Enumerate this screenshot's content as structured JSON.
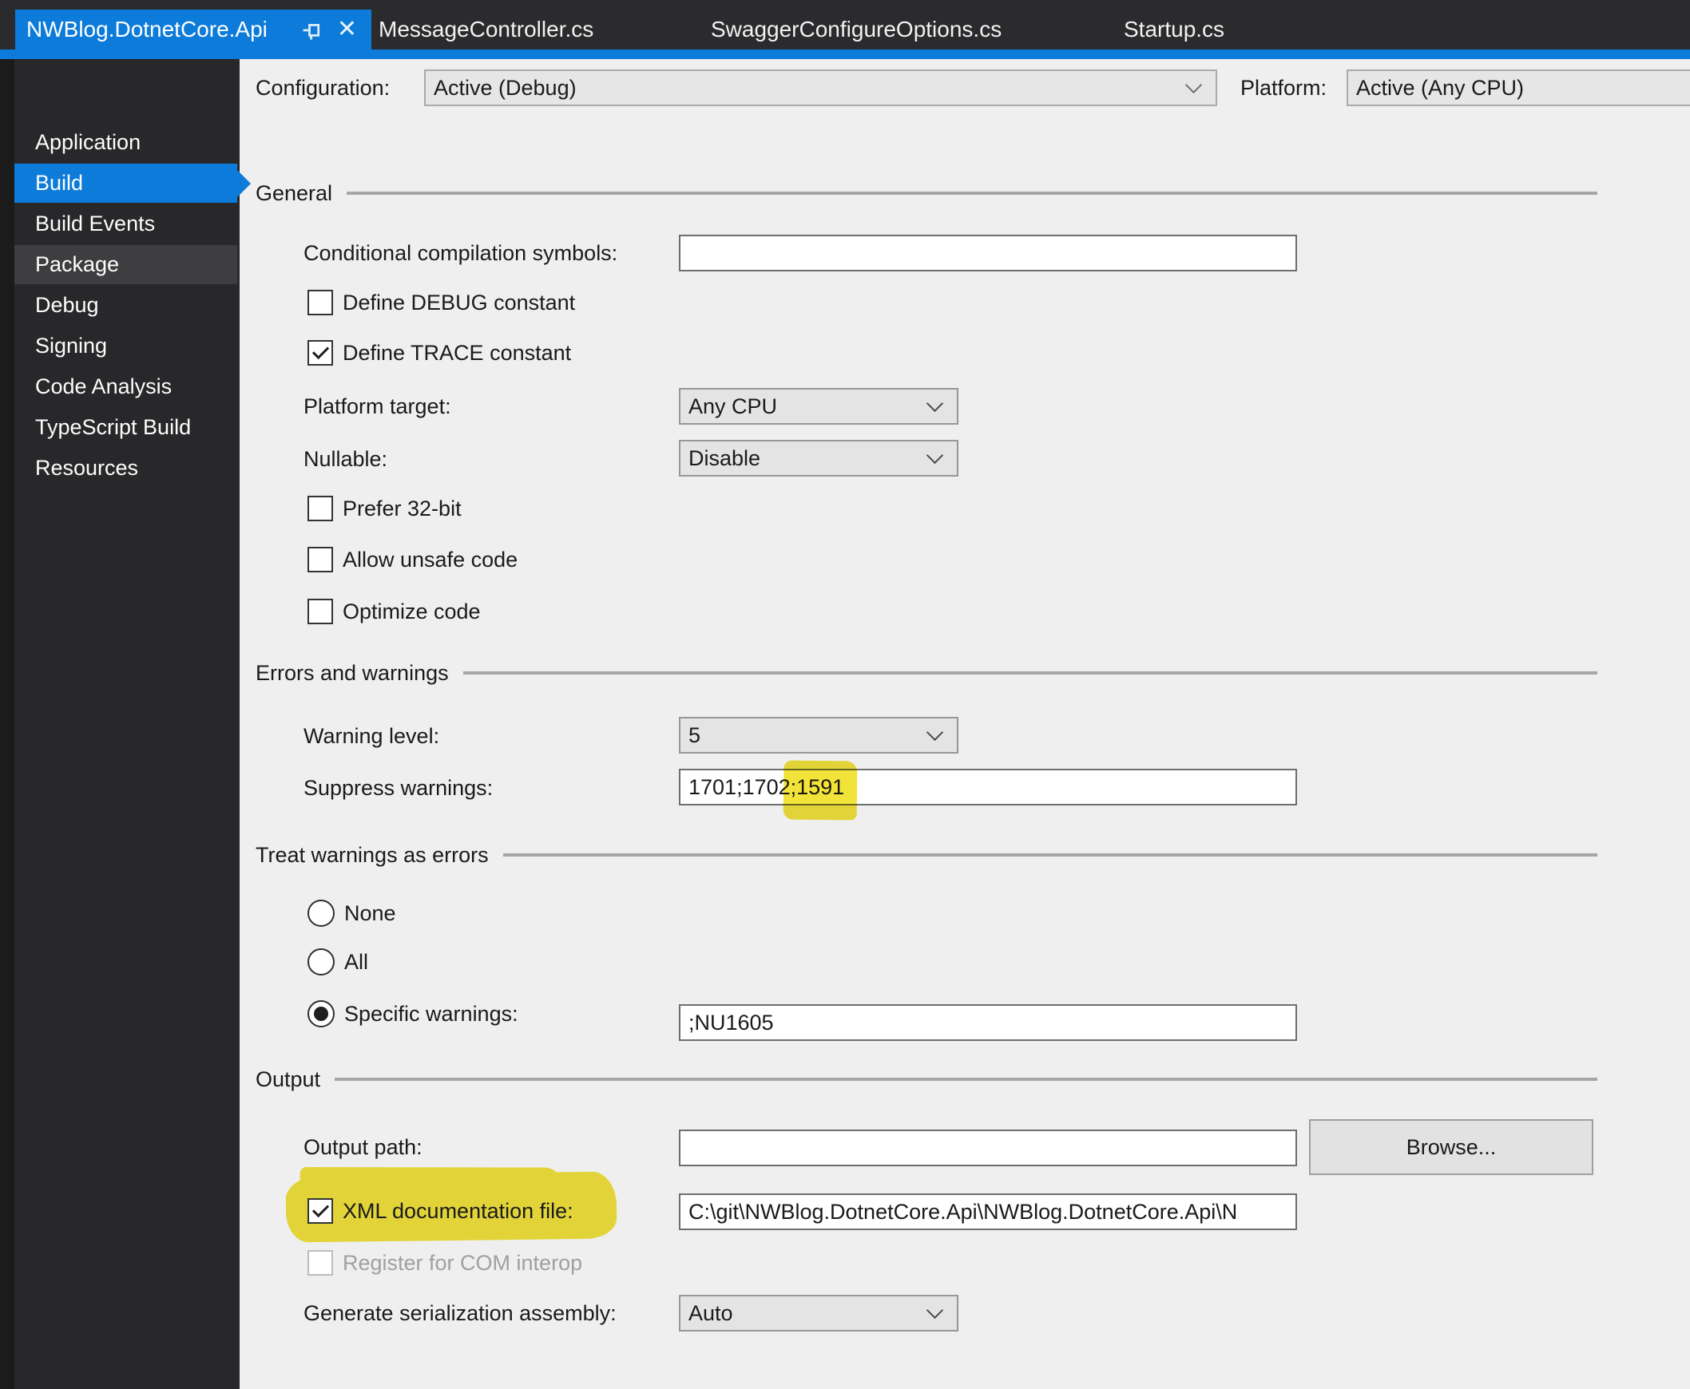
{
  "tabbar": {
    "active_tab": {
      "label": "NWBlog.DotnetCore.Api"
    },
    "tabs": [
      {
        "label": "MessageController.cs"
      },
      {
        "label": "SwaggerConfigureOptions.cs"
      },
      {
        "label": "Startup.cs"
      }
    ]
  },
  "sidebar": {
    "items": [
      {
        "label": "Application",
        "selected": false,
        "highlighted": false
      },
      {
        "label": "Build",
        "selected": true,
        "highlighted": false
      },
      {
        "label": "Build Events",
        "selected": false,
        "highlighted": false
      },
      {
        "label": "Package",
        "selected": false,
        "highlighted": true
      },
      {
        "label": "Debug",
        "selected": false,
        "highlighted": false
      },
      {
        "label": "Signing",
        "selected": false,
        "highlighted": false
      },
      {
        "label": "Code Analysis",
        "selected": false,
        "highlighted": false
      },
      {
        "label": "TypeScript Build",
        "selected": false,
        "highlighted": false
      },
      {
        "label": "Resources",
        "selected": false,
        "highlighted": false
      }
    ]
  },
  "header": {
    "configuration_label": "Configuration:",
    "configuration_value": "Active (Debug)",
    "platform_label": "Platform:",
    "platform_value": "Active (Any CPU)"
  },
  "general": {
    "title": "General",
    "conditional_symbols": {
      "label": "Conditional compilation symbols:",
      "value": ""
    },
    "define_debug": {
      "label": "Define DEBUG constant",
      "checked": false
    },
    "define_trace": {
      "label": "Define TRACE constant",
      "checked": true
    },
    "platform_target": {
      "label": "Platform target:",
      "value": "Any CPU"
    },
    "nullable": {
      "label": "Nullable:",
      "value": "Disable"
    },
    "prefer_32bit": {
      "label": "Prefer 32-bit",
      "checked": false
    },
    "allow_unsafe": {
      "label": "Allow unsafe code",
      "checked": false
    },
    "optimize_code": {
      "label": "Optimize code",
      "checked": false
    }
  },
  "errors_warnings": {
    "title": "Errors and warnings",
    "warning_level": {
      "label": "Warning level:",
      "value": "5"
    },
    "suppress_warnings": {
      "label": "Suppress warnings:",
      "value": "1701;1702;1591",
      "highlighted_part": "1591"
    }
  },
  "treat_warnings": {
    "title": "Treat warnings as errors",
    "none": {
      "label": "None",
      "selected": false
    },
    "all": {
      "label": "All",
      "selected": false
    },
    "specific": {
      "label": "Specific warnings:",
      "selected": true,
      "value": ";NU1605"
    }
  },
  "output": {
    "title": "Output",
    "output_path": {
      "label": "Output path:",
      "value": ""
    },
    "browse_label": "Browse...",
    "xml_documentation": {
      "label": "XML documentation file:",
      "checked": true,
      "highlighted": true,
      "value": "C:\\git\\NWBlog.DotnetCore.Api\\NWBlog.DotnetCore.Api\\N"
    },
    "register_com": {
      "label": "Register for COM interop",
      "checked": false,
      "disabled": true
    },
    "generate_serialization": {
      "label": "Generate serialization assembly:",
      "value": "Auto"
    }
  },
  "colors": {
    "accent": "#0c7bd9",
    "highlight": "#f2e33b",
    "tabbar_bg": "#2b2b2e",
    "sidebar_bg": "#28282a",
    "content_bg": "#efefef"
  }
}
